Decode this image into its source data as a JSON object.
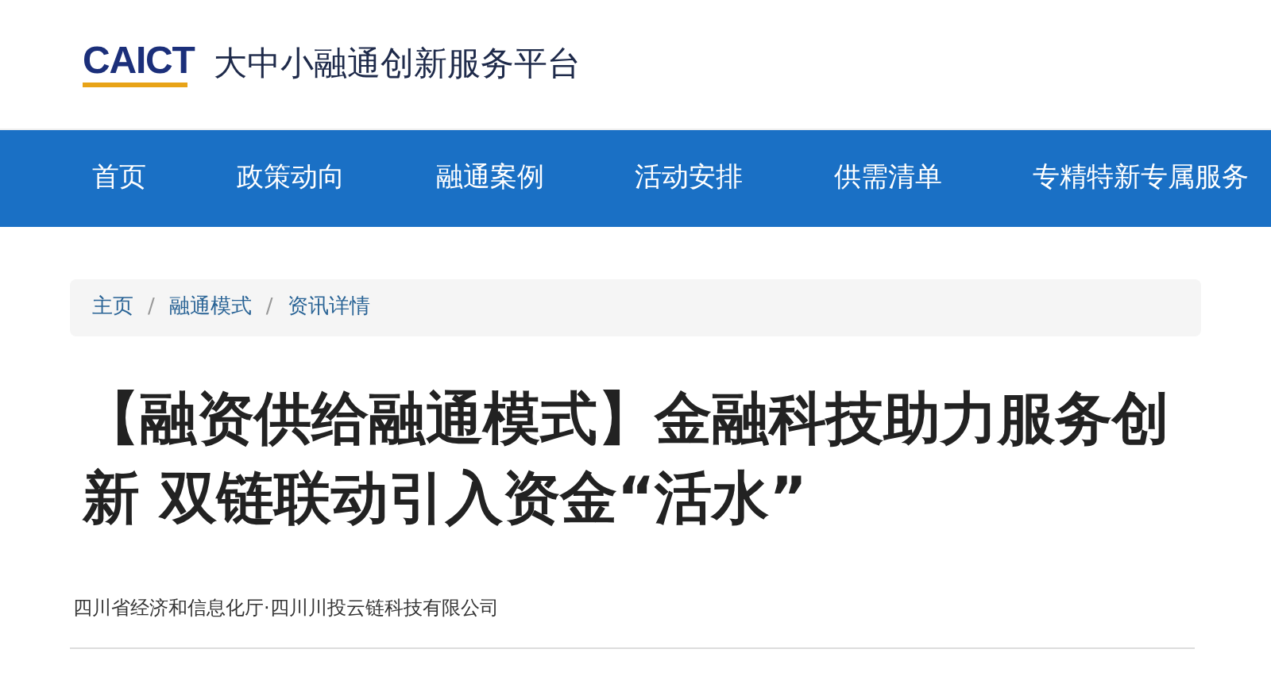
{
  "header": {
    "logo": "CAICT",
    "site_title": "大中小融通创新服务平台"
  },
  "nav": {
    "items": [
      {
        "label": "首页"
      },
      {
        "label": "政策动向"
      },
      {
        "label": "融通案例"
      },
      {
        "label": "活动安排"
      },
      {
        "label": "供需清单"
      },
      {
        "label": "专精特新专属服务"
      }
    ]
  },
  "breadcrumb": [
    {
      "kind": "link",
      "text": "主页"
    },
    {
      "kind": "separator",
      "text": "/"
    },
    {
      "kind": "link",
      "text": "融通模式"
    },
    {
      "kind": "separator",
      "text": "/"
    },
    {
      "kind": "current",
      "text": "资讯详情"
    }
  ],
  "article": {
    "title": "【融资供给融通模式】金融科技助力服务创新 双链联动引入资金“活水”",
    "source": "四川省经济和信息化厅·四川川投云链科技有限公司"
  }
}
